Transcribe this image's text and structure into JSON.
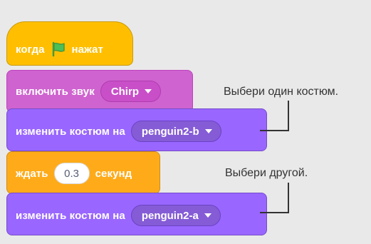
{
  "blocks": {
    "when_flag": {
      "before": "когда",
      "after": "нажат",
      "icon": "green-flag-icon"
    },
    "play_sound": {
      "label": "включить звук",
      "sound": "Chirp"
    },
    "switch_costume_1": {
      "label": "изменить костюм на",
      "costume": "penguin2-b"
    },
    "wait": {
      "before": "ждать",
      "value": "0.3",
      "after": "секунд"
    },
    "switch_costume_2": {
      "label": "изменить костюм на",
      "costume": "penguin2-a"
    }
  },
  "callouts": {
    "first": "Выбери один костюм.",
    "second": "Выбери другой."
  },
  "colors": {
    "events": "#ffbf00",
    "sound": "#cf63cf",
    "looks": "#9966ff",
    "control": "#ffab19",
    "background": "#e9e9e9"
  }
}
